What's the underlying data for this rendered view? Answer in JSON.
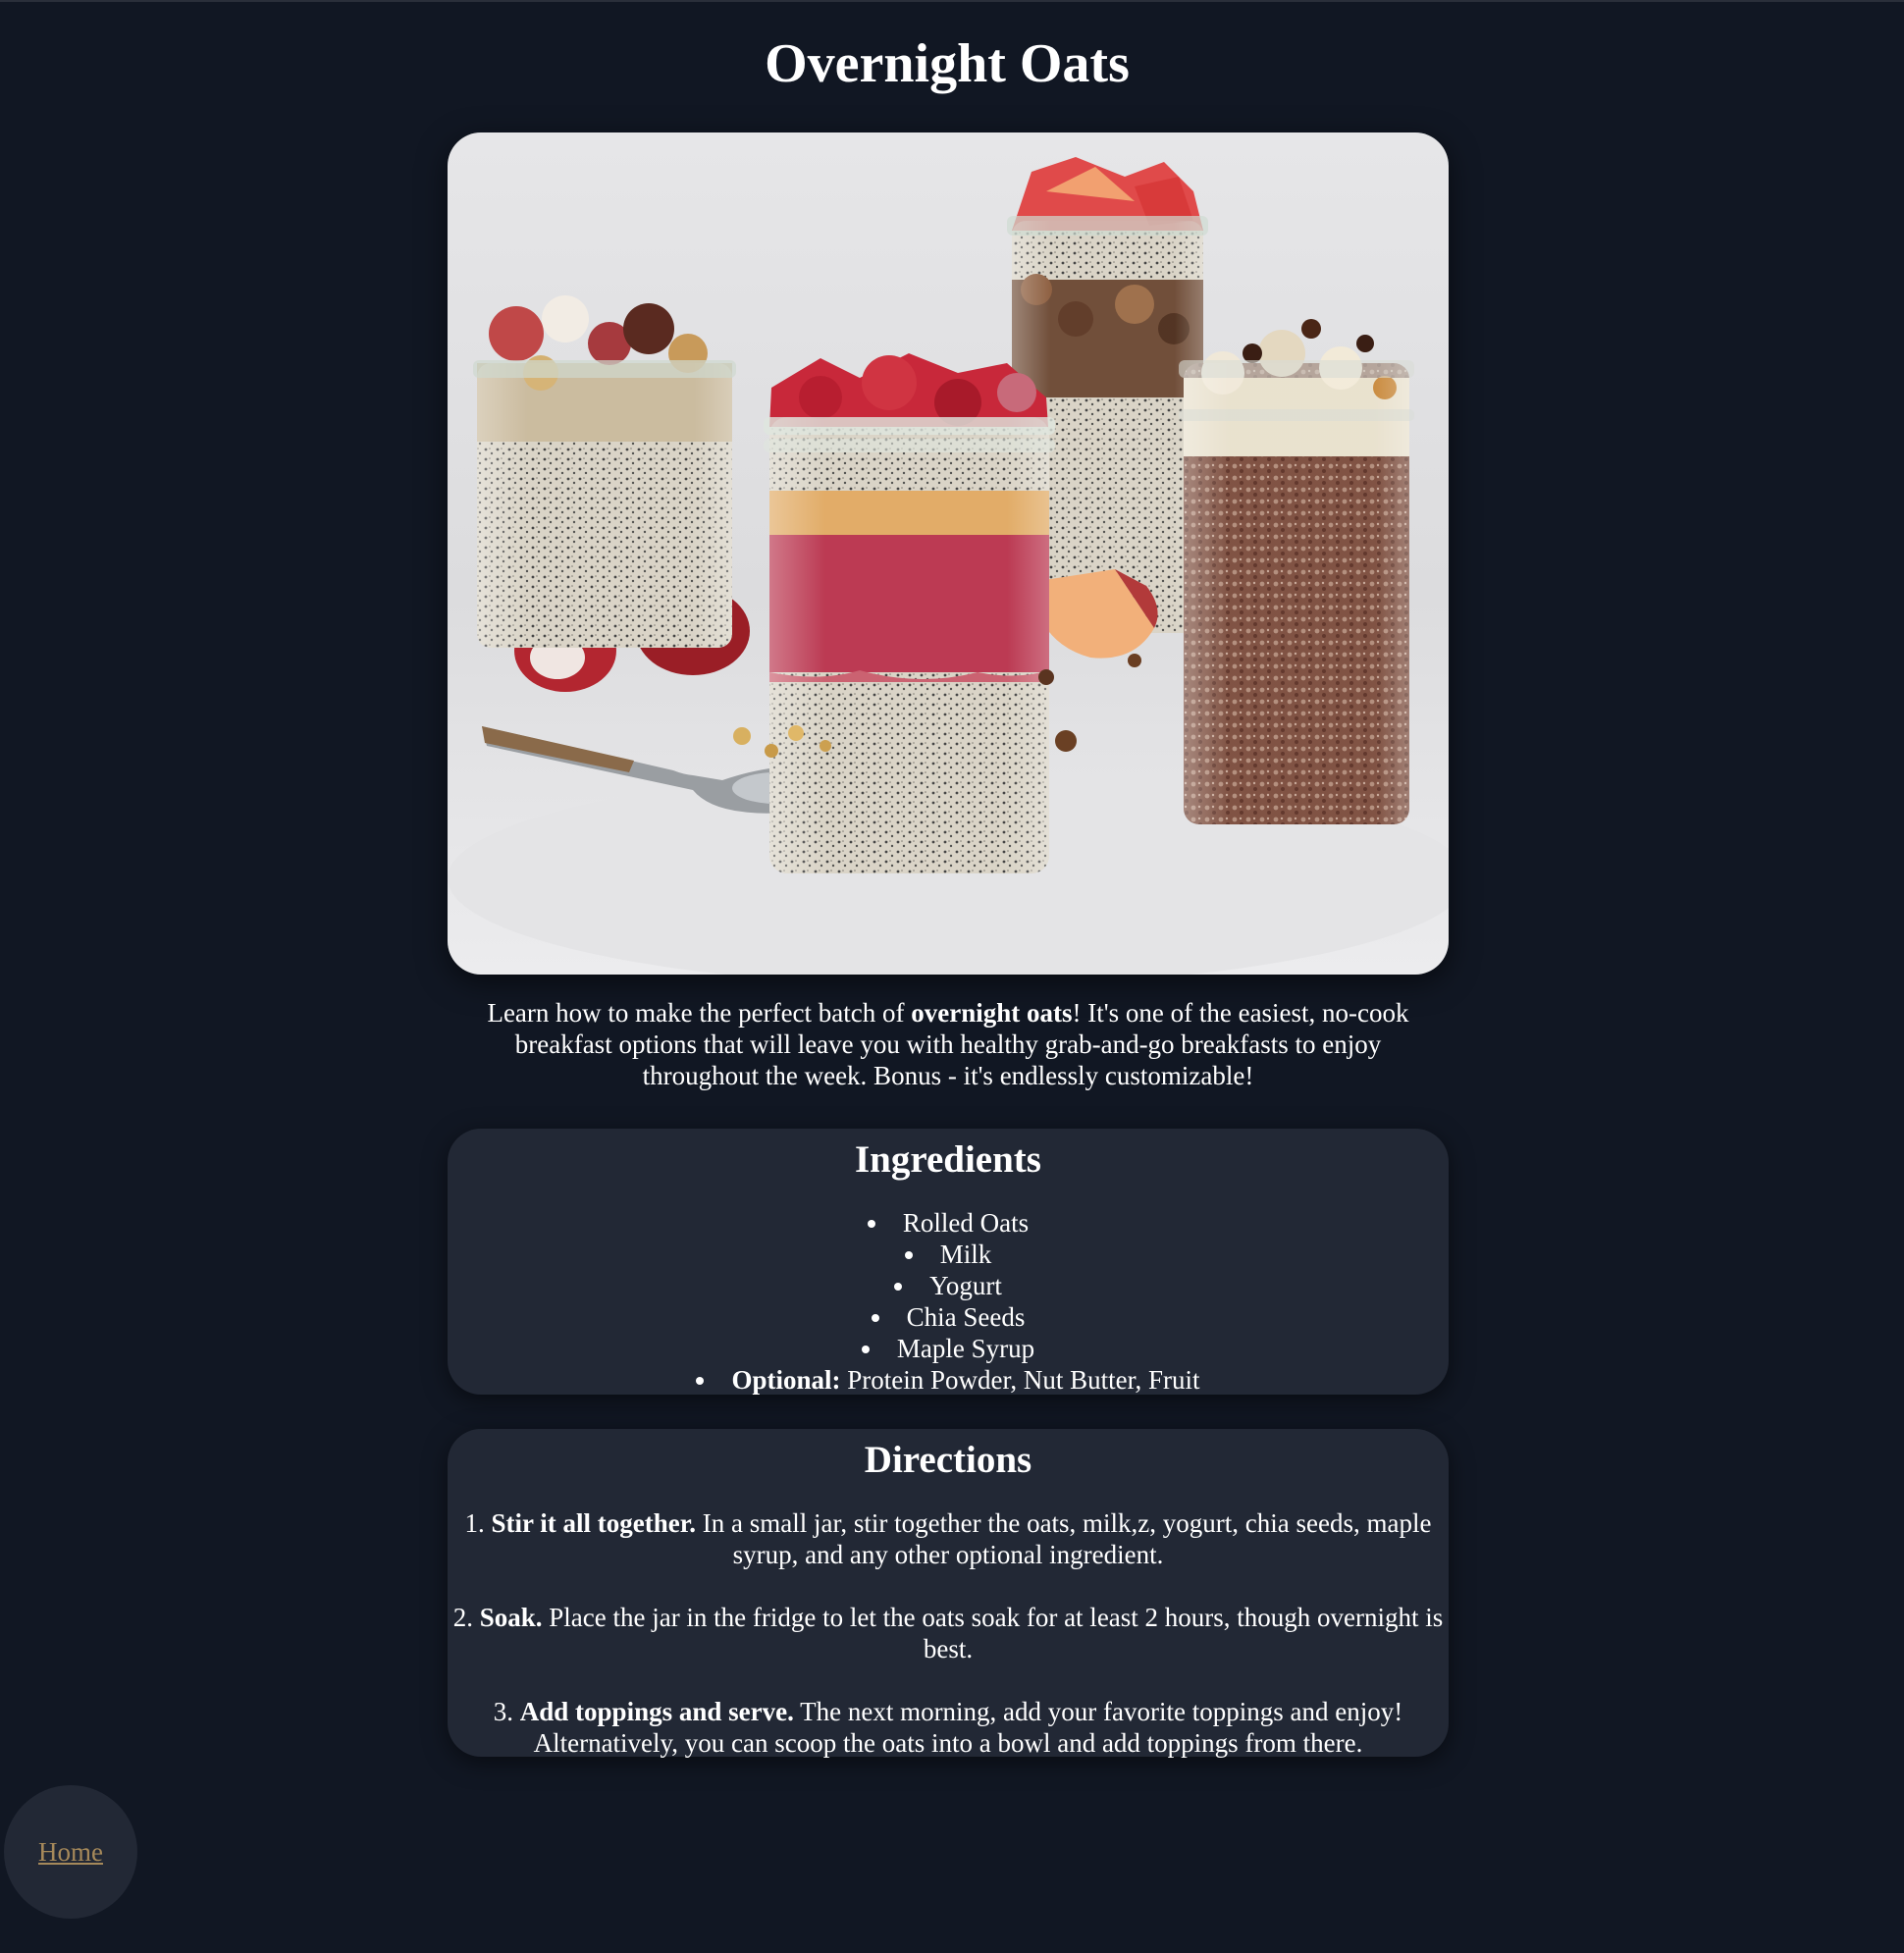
{
  "page": {
    "title": "Overnight Oats"
  },
  "hero_image": {
    "alt": "Jars of overnight oats topped with strawberries, peaches, granola and banana, with a spoon"
  },
  "intro": {
    "before": "Learn how to make the perfect batch of ",
    "bold": "overnight oats",
    "after": "! It's one of the easiest, no-cook breakfast options that will leave you with healthy grab-and-go breakfasts to enjoy throughout the week. Bonus - it's endlessly customizable!"
  },
  "ingredients": {
    "heading": "Ingredients",
    "items": [
      "Rolled Oats",
      "Milk",
      "Yogurt",
      "Chia Seeds",
      "Maple Syrup"
    ],
    "optional_label": "Optional:",
    "optional_text": " Protein Powder, Nut Butter, Fruit"
  },
  "directions": {
    "heading": "Directions",
    "steps": [
      {
        "title": "Stir it all together.",
        "text": " In a small jar, stir together the oats, milk,z, yogurt, chia seeds, maple syrup, and any other optional ingredient."
      },
      {
        "title": "Soak.",
        "text": " Place the jar in the fridge to let the oats soak for at least 2 hours, though overnight is best."
      },
      {
        "title": "Add toppings and serve.",
        "text": " The next morning, add your favorite toppings and enjoy! Alternatively, you can scoop the oats into a bowl and add toppings from there."
      }
    ]
  },
  "nav": {
    "home_label": "Home"
  },
  "colors": {
    "background": "#111723",
    "card": "#222835",
    "link": "#a6895a"
  }
}
